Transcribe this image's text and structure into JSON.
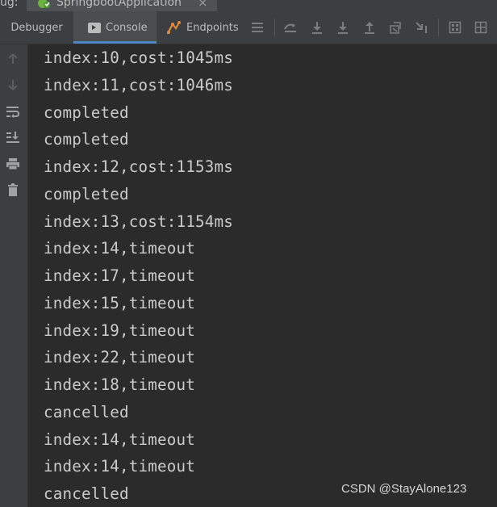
{
  "run_tabs": {
    "label": "ug:",
    "active_tab": "SpringbootApplication",
    "close_symbol": "×"
  },
  "toolbar": {
    "tabs": [
      {
        "label": "Debugger"
      },
      {
        "label": "Console"
      },
      {
        "label": "Endpoints"
      }
    ],
    "icons": [
      "menu-icon",
      "show-execution-point-icon",
      "step-over-icon",
      "step-into-icon",
      "step-out-icon",
      "drop-frame-icon",
      "run-to-cursor-icon",
      "evaluate-expression-icon",
      "layout-icon"
    ]
  },
  "gutter_icons": [
    "up-arrow-icon",
    "down-arrow-icon",
    "soft-wrap-icon",
    "scroll-to-end-icon",
    "print-icon",
    "clear-all-icon"
  ],
  "console": {
    "lines": [
      "index:10,cost:1045ms",
      "index:11,cost:1046ms",
      "completed",
      "completed",
      "index:12,cost:1153ms",
      "completed",
      "index:13,cost:1154ms",
      "index:14,timeout",
      "index:17,timeout",
      "index:15,timeout",
      "index:19,timeout",
      "index:22,timeout",
      "index:18,timeout",
      "cancelled",
      "index:14,timeout",
      "index:14,timeout",
      "cancelled"
    ]
  },
  "watermark": "CSDN @StayAlone123",
  "colors": {
    "accent": "#4a88c7",
    "spring_green": "#6cb33e",
    "endpoints_orange": "#e08a3c"
  }
}
